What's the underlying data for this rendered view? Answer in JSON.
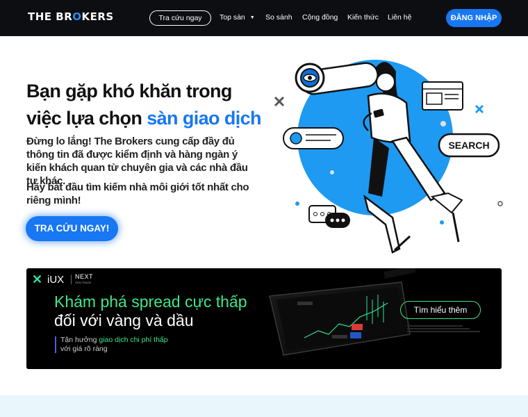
{
  "header": {
    "logo_prefix": "THE BR",
    "logo_accent": "O",
    "logo_suffix": "KERS",
    "nav_search": "Tra cứu ngay",
    "nav": [
      {
        "label": "Top sàn"
      },
      {
        "label": "So sánh"
      },
      {
        "label": "Cộng đồng"
      },
      {
        "label": "Kiến thức"
      },
      {
        "label": "Liên hệ"
      }
    ],
    "login_label": "ĐĂNG NHẬP"
  },
  "hero": {
    "title_line1": "Bạn gặp khó khăn trong",
    "title_line2_prefix": "việc lựa chọn ",
    "title_line2_highlight": "sàn giao dịch",
    "desc": "Đừng lo lắng! The Brokers cung cấp đầy đủ thông tin đã được kiểm định và hàng ngàn ý kiến khách quan từ chuyên gia và các nhà đầu tư khác.",
    "desc2": "Hãy bắt đầu tìm kiếm nhà môi giới tốt nhất cho riêng mình!",
    "cta_label": "TRA CỨU NGAY!",
    "illustration_search_label": "SEARCH"
  },
  "banner": {
    "brand_name": "iUX",
    "brand_tag": "NEXT",
    "brand_tag_sub": "GEN TRADE",
    "headline_green": "Khám phá spread cực thấp",
    "headline_white": "đối với vàng và dầu",
    "sub_prefix": "Tận hưởng ",
    "sub_highlight": "giao dịch chi phí thấp",
    "sub_line2": "với giá rõ ràng",
    "cta_label": "Tìm hiểu thêm"
  },
  "colors": {
    "primary": "#1877f2",
    "header_bg": "#0d0e12",
    "banner_green": "#3ee78a",
    "bottom_band": "#e9f6fb"
  }
}
